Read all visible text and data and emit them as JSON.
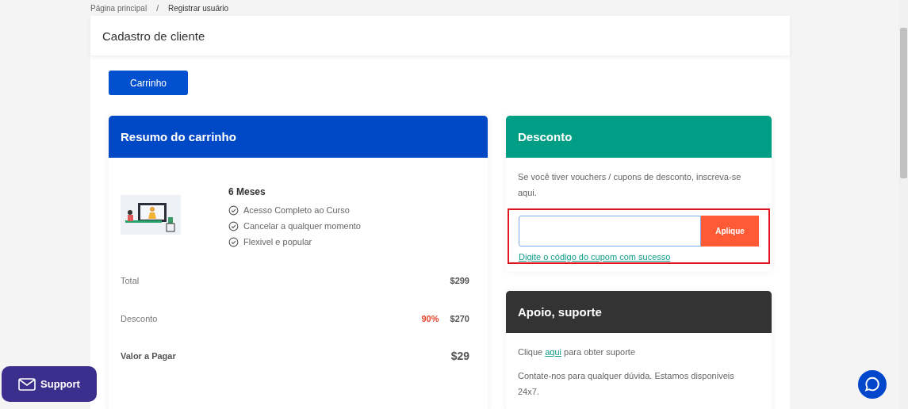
{
  "breadcrumb": [
    {
      "label": "Página principal",
      "current": false
    },
    {
      "label": "Registrar usuário",
      "current": true
    }
  ],
  "breadcrumb_separator": "/",
  "page_title": "Cadastro de cliente",
  "cart_button": "Carrinho",
  "cart_summary": {
    "title": "Resumo do carrinho",
    "plan": "6 Meses",
    "features": [
      "Acesso Completo ao Curso",
      "Cancelar a qualquer momento",
      "Flexivel e popular"
    ],
    "rows": [
      {
        "label": "Total",
        "amount": "$299",
        "emphasis": false
      },
      {
        "label": "Desconto",
        "percent": "90%",
        "amount": "$270",
        "emphasis": false
      },
      {
        "label": "Valor a Pagar",
        "amount": "$29",
        "emphasis": true
      }
    ]
  },
  "discount": {
    "title": "Desconto",
    "text": "Se você tiver vouchers / cupons de desconto, inscreva-se aqui.",
    "apply_button": "Aplique",
    "highlighted": true,
    "message": "Digite o código do cupom com sucesso"
  },
  "support_card": {
    "title": "Apoio, suporte",
    "line_before": "Clique ",
    "link": "aqui",
    "line_after": " para obter suporte",
    "text": "Contate-nos para qualquer dúvida. Estamos disponiveis 24x7."
  },
  "support_button": "Support"
}
